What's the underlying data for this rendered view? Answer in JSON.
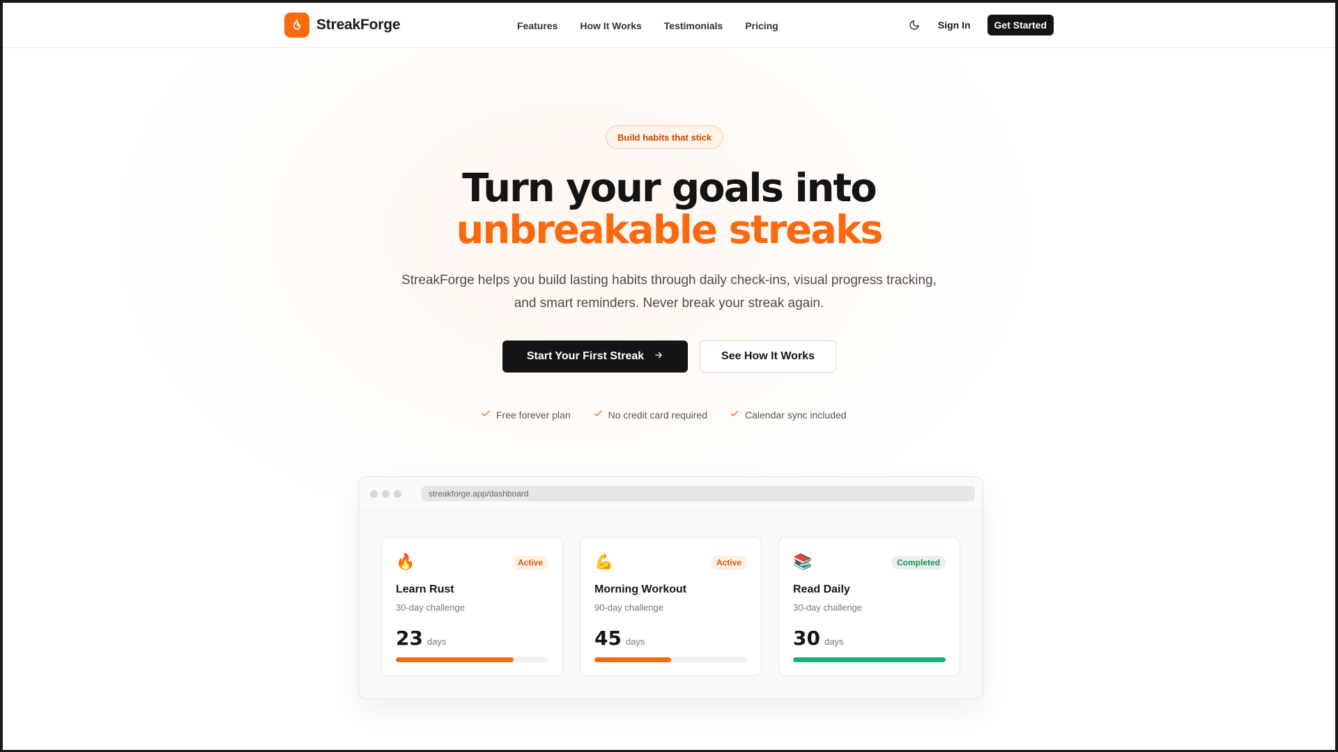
{
  "brand": {
    "name": "StreakForge",
    "accent": "#f96a10"
  },
  "nav": {
    "links": [
      "Features",
      "How It Works",
      "Testimonials",
      "Pricing"
    ],
    "theme_icon": "moon-icon",
    "sign_in": "Sign In",
    "get_started": "Get Started"
  },
  "hero": {
    "pill": "Build habits that stick",
    "title_line1": "Turn your goals into",
    "title_line2": "unbreakable streaks",
    "subtitle": "StreakForge helps you build lasting habits through daily check-ins, visual progress tracking, and smart reminders. Never break your streak again.",
    "primary_cta": "Start Your First Streak",
    "secondary_cta": "See How It Works",
    "checks": [
      "Free forever plan",
      "No credit card required",
      "Calendar sync included"
    ]
  },
  "dashboard": {
    "url": "streakforge.app/dashboard",
    "cards": [
      {
        "emoji": "🔥",
        "status": "Active",
        "title": "Learn Rust",
        "subtitle": "30-day challenge",
        "days": "23",
        "unit": "days",
        "progress": 0.77,
        "color": "#f96a10"
      },
      {
        "emoji": "💪",
        "status": "Active",
        "title": "Morning Workout",
        "subtitle": "90-day challenge",
        "days": "45",
        "unit": "days",
        "progress": 0.5,
        "color": "#f96a10"
      },
      {
        "emoji": "📚",
        "status": "Completed",
        "title": "Read Daily",
        "subtitle": "30-day challenge",
        "days": "30",
        "unit": "days",
        "progress": 1.0,
        "color": "#19b07a"
      }
    ]
  }
}
